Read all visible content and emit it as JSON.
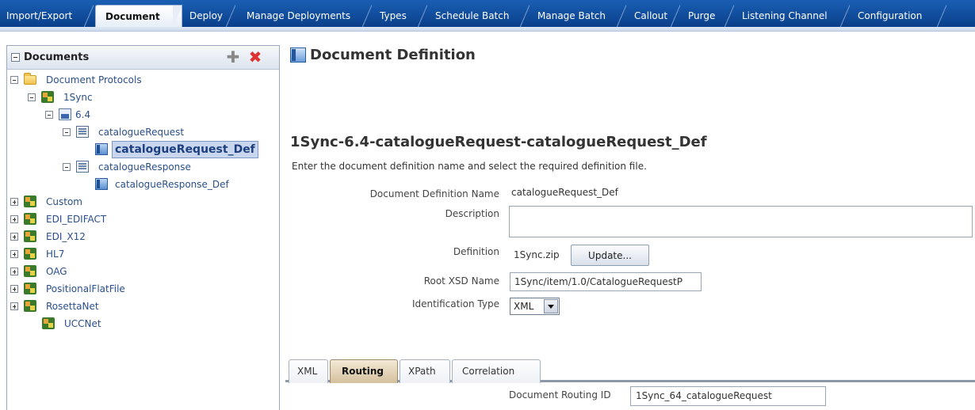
{
  "top_tabs": [
    {
      "label": "Import/Export"
    },
    {
      "label": "Document",
      "active": true
    },
    {
      "label": "Deploy"
    },
    {
      "label": "Manage Deployments"
    },
    {
      "label": "Types"
    },
    {
      "label": "Schedule Batch"
    },
    {
      "label": "Manage Batch"
    },
    {
      "label": "Callout"
    },
    {
      "label": "Purge"
    },
    {
      "label": "Listening Channel"
    },
    {
      "label": "Configuration"
    }
  ],
  "left_panel": {
    "title": "Documents",
    "tree": {
      "root": "Document Protocols",
      "sync": "1Sync",
      "version": "6.4",
      "catalogue_request": "catalogueRequest",
      "catalogue_request_def": "catalogueRequest_Def",
      "catalogue_response": "catalogueResponse",
      "catalogue_response_def": "catalogueResponse_Def",
      "custom": "Custom",
      "edifact": "EDI_EDIFACT",
      "x12": "EDI_X12",
      "hl7": "HL7",
      "oag": "OAG",
      "positional": "PositionalFlatFile",
      "rosettanet": "RosettaNet",
      "uccnet": "UCCNet"
    }
  },
  "main": {
    "page_title": "Document Definition",
    "definition_title": "1Sync-6.4-catalogueRequest-catalogueRequest_Def",
    "instruction": "Enter the document definition name and select the required definition file.",
    "fields": {
      "name_label": "Document Definition Name",
      "name_value": "catalogueRequest_Def",
      "description_label": "Description",
      "description_value": "",
      "definition_label": "Definition",
      "definition_value": "1Sync.zip",
      "update_button": "Update...",
      "root_xsd_label": "Root XSD Name",
      "root_xsd_value": "1Sync/item/1.0/CatalogueRequestP",
      "identification_label": "Identification Type",
      "identification_value": "XML"
    },
    "sub_tabs": [
      {
        "label": "XML"
      },
      {
        "label": "Routing",
        "active": true
      },
      {
        "label": "XPath"
      },
      {
        "label": "Correlation"
      }
    ],
    "routing": {
      "id_label": "Document Routing ID",
      "id_value": "1Sync_64_catalogueRequest"
    }
  }
}
